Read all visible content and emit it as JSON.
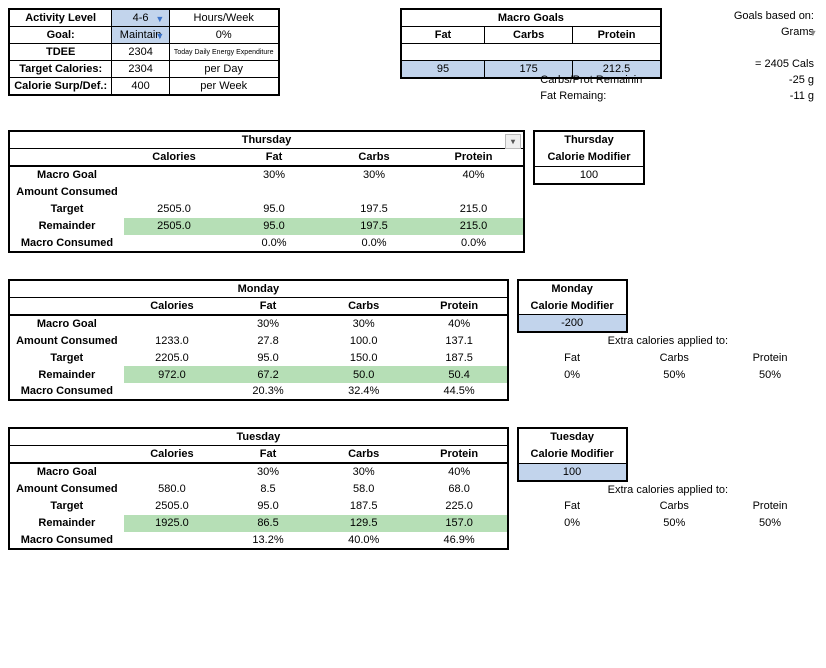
{
  "summary": {
    "rows": [
      {
        "label": "Activity Level",
        "value": "4-6",
        "value_dropdown": true,
        "extra": "Hours/Week"
      },
      {
        "label": "Goal:",
        "value": "Maintain",
        "value_dropdown": true,
        "extra": "0%"
      },
      {
        "label": "TDEE",
        "value": "2304",
        "extra_tiny": "Today Daily Energy Expenditure"
      },
      {
        "label": "Target Calories:",
        "value": "2304",
        "extra": "per Day"
      },
      {
        "label": "Calorie Surp/Def.:",
        "value": "400",
        "extra": "per Week"
      }
    ]
  },
  "macro_goals": {
    "title": "Macro Goals",
    "headers": [
      "Fat",
      "Carbs",
      "Protein"
    ],
    "values": [
      "95",
      "175",
      "212.5"
    ],
    "based_on_label": "Goals based on:",
    "based_on_value": "Grams",
    "equals_label": "= 2405 Cals",
    "footer": [
      {
        "label": "Carbs/Prot Remainin",
        "value": "-25 g"
      },
      {
        "label": "Fat Remaing:",
        "value": "-11 g"
      }
    ]
  },
  "days": [
    {
      "name": "Thursday",
      "modifier_label": "Thursday",
      "modifier_sub": "Calorie Modifier",
      "modifier_value": "100",
      "modifier_blue": false,
      "cols": [
        "Calories",
        "Fat",
        "Carbs",
        "Protein"
      ],
      "rows": [
        {
          "label": "Macro Goal",
          "vals": [
            "",
            "30%",
            "30%",
            "40%"
          ]
        },
        {
          "label": "Amount Consumed",
          "vals": [
            "",
            "",
            "",
            ""
          ]
        },
        {
          "label": "Target",
          "vals": [
            "2505.0",
            "95.0",
            "197.5",
            "215.0"
          ]
        },
        {
          "label": "Remainder",
          "vals": [
            "2505.0",
            "95.0",
            "197.5",
            "215.0"
          ],
          "green": true
        },
        {
          "label": "Macro Consumed",
          "vals": [
            "",
            "0.0%",
            "0.0%",
            "0.0%"
          ]
        }
      ],
      "show_extra": false,
      "show_header_dropdown": true
    },
    {
      "name": "Monday",
      "modifier_label": "Monday",
      "modifier_sub": "Calorie Modifier",
      "modifier_value": "-200",
      "modifier_blue": true,
      "cols": [
        "Calories",
        "Fat",
        "Carbs",
        "Protein"
      ],
      "rows": [
        {
          "label": "Macro Goal",
          "vals": [
            "",
            "30%",
            "30%",
            "40%"
          ]
        },
        {
          "label": "Amount Consumed",
          "vals": [
            "1233.0",
            "27.8",
            "100.0",
            "137.1"
          ]
        },
        {
          "label": "Target",
          "vals": [
            "2205.0",
            "95.0",
            "150.0",
            "187.5"
          ]
        },
        {
          "label": "Remainder",
          "vals": [
            "972.0",
            "67.2",
            "50.0",
            "50.4"
          ],
          "green": true
        },
        {
          "label": "Macro Consumed",
          "vals": [
            "",
            "20.3%",
            "32.4%",
            "44.5%"
          ]
        }
      ],
      "show_extra": true,
      "extra_title": "Extra calories applied to:",
      "extra_headers": [
        "Fat",
        "Carbs",
        "Protein"
      ],
      "extra_values": [
        "0%",
        "50%",
        "50%"
      ],
      "show_header_dropdown": false
    },
    {
      "name": "Tuesday",
      "modifier_label": "Tuesday",
      "modifier_sub": "Calorie Modifier",
      "modifier_value": "100",
      "modifier_blue": true,
      "cols": [
        "Calories",
        "Fat",
        "Carbs",
        "Protein"
      ],
      "rows": [
        {
          "label": "Macro Goal",
          "vals": [
            "",
            "30%",
            "30%",
            "40%"
          ]
        },
        {
          "label": "Amount Consumed",
          "vals": [
            "580.0",
            "8.5",
            "58.0",
            "68.0"
          ]
        },
        {
          "label": "Target",
          "vals": [
            "2505.0",
            "95.0",
            "187.5",
            "225.0"
          ]
        },
        {
          "label": "Remainder",
          "vals": [
            "1925.0",
            "86.5",
            "129.5",
            "157.0"
          ],
          "green": true
        },
        {
          "label": "Macro Consumed",
          "vals": [
            "",
            "13.2%",
            "40.0%",
            "46.9%"
          ]
        }
      ],
      "show_extra": true,
      "extra_title": "Extra calories applied to:",
      "extra_headers": [
        "Fat",
        "Carbs",
        "Protein"
      ],
      "extra_values": [
        "0%",
        "50%",
        "50%"
      ],
      "show_header_dropdown": false
    }
  ]
}
